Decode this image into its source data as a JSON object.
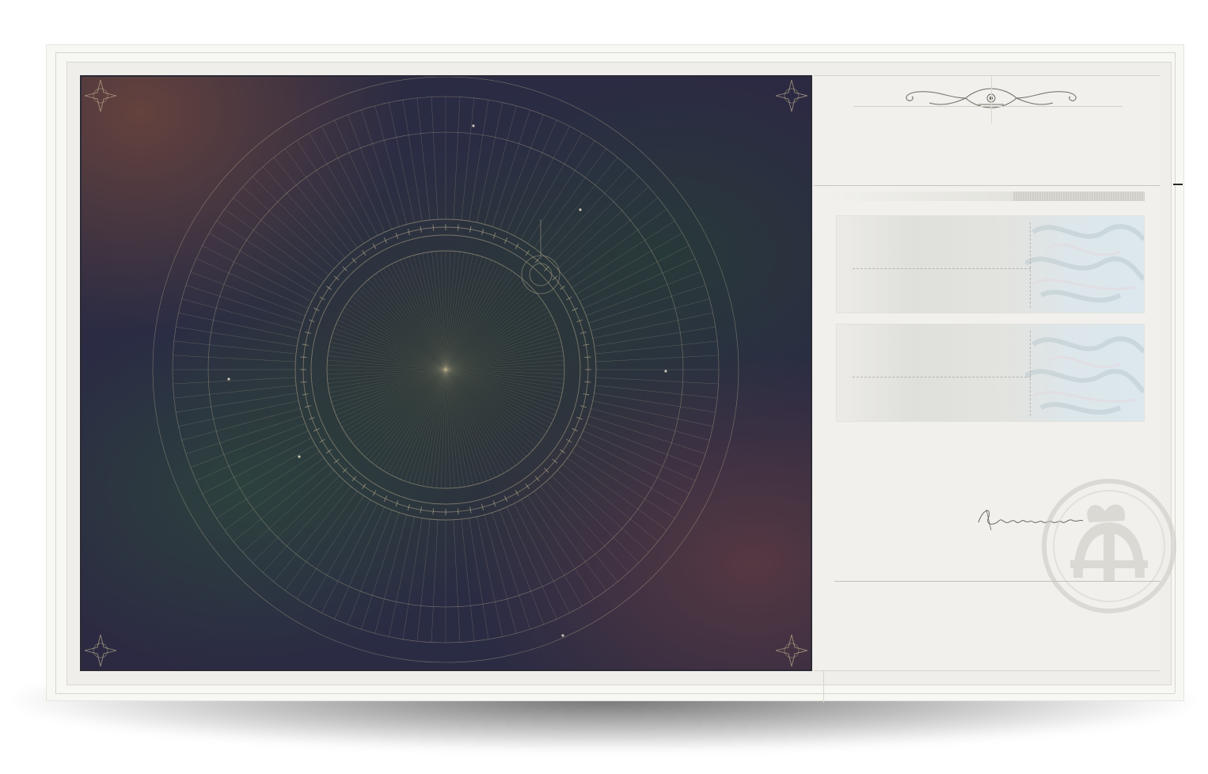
{
  "colors": {
    "art_background": "#2b2c43",
    "art_lines": "#b9ad8c",
    "paper": "#f1f0ec",
    "frame": "#efeeea"
  },
  "icons": {
    "art_corner_ornament": "compass-star-icon",
    "header_ornament": "eye-flourish-icon",
    "seal": "monogram-seal-icon"
  }
}
